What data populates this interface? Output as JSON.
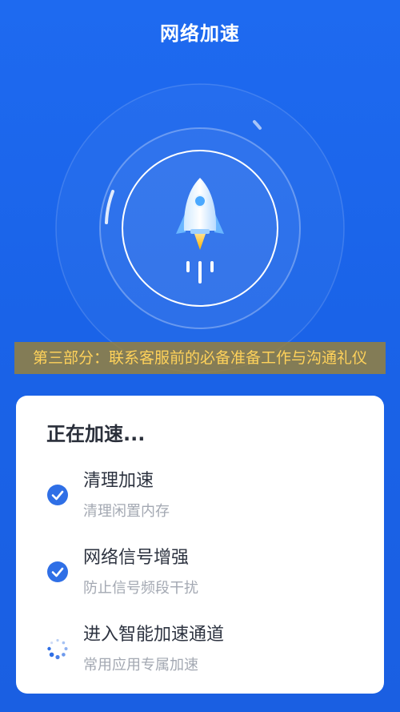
{
  "header": {
    "title": "网络加速"
  },
  "hero": {
    "rocket_icon": "rocket-icon",
    "ring_color": "#ffffff"
  },
  "banner": {
    "text": "第三部分：联系客服前的必备准备工作与沟通礼仪"
  },
  "card": {
    "title": "正在加速...",
    "steps": [
      {
        "name": "清理加速",
        "desc": "清理闲置内存",
        "status": "done",
        "icon": "check-circle-icon"
      },
      {
        "name": "网络信号增强",
        "desc": "防止信号频段干扰",
        "status": "done",
        "icon": "check-circle-icon"
      },
      {
        "name": "进入智能加速通道",
        "desc": "常用应用专属加速",
        "status": "loading",
        "icon": "loading-spinner-icon"
      }
    ]
  },
  "colors": {
    "background": "#1a63e8",
    "accent": "#2f6fe6",
    "banner_text": "#ffd25a"
  }
}
